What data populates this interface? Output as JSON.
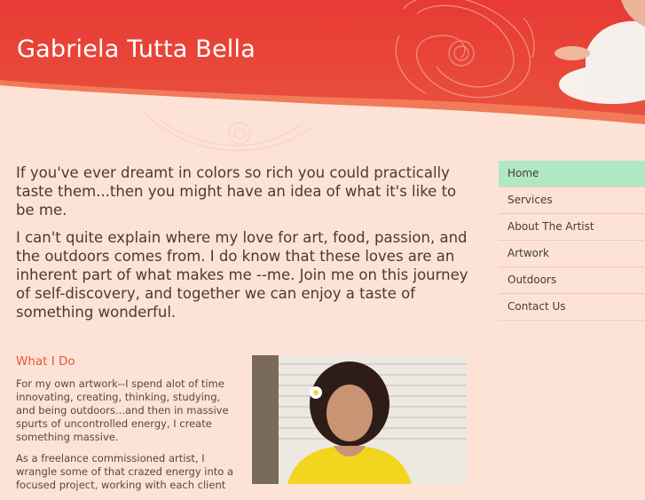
{
  "header": {
    "site_title": "Gabriela Tutta Bella"
  },
  "intro": {
    "paragraphs": [
      "If you've ever dreamt in colors so rich you could practically taste them...then you might have an idea of what it's like to be me.",
      "I can't quite explain where my love for art, food, passion, and the outdoors comes from. I do know that these loves are an inherent part of what makes me --me. Join me on this journey of self-discovery, and together we can enjoy a taste of something wonderful."
    ]
  },
  "nav": {
    "items": [
      {
        "label": "Home",
        "active": true
      },
      {
        "label": "Services",
        "active": false
      },
      {
        "label": "About The Artist",
        "active": false
      },
      {
        "label": "Artwork",
        "active": false
      },
      {
        "label": "Outdoors",
        "active": false
      },
      {
        "label": "Contact Us",
        "active": false
      }
    ]
  },
  "what_i_do": {
    "heading": "What I Do",
    "paragraphs": [
      "For my own artwork--I spend alot of time innovating, creating, thinking, studying, and being outdoors...and then in massive spurts of uncontrolled energy, I create something massive.",
      "As a freelance commissioned artist, I wrangle some of that crazed energy into a focused project, working with each client"
    ]
  },
  "colors": {
    "header_red": "#e8413a",
    "background": "#fde3d6",
    "accent_orange": "#e8573a",
    "nav_active": "#aee9c4"
  }
}
